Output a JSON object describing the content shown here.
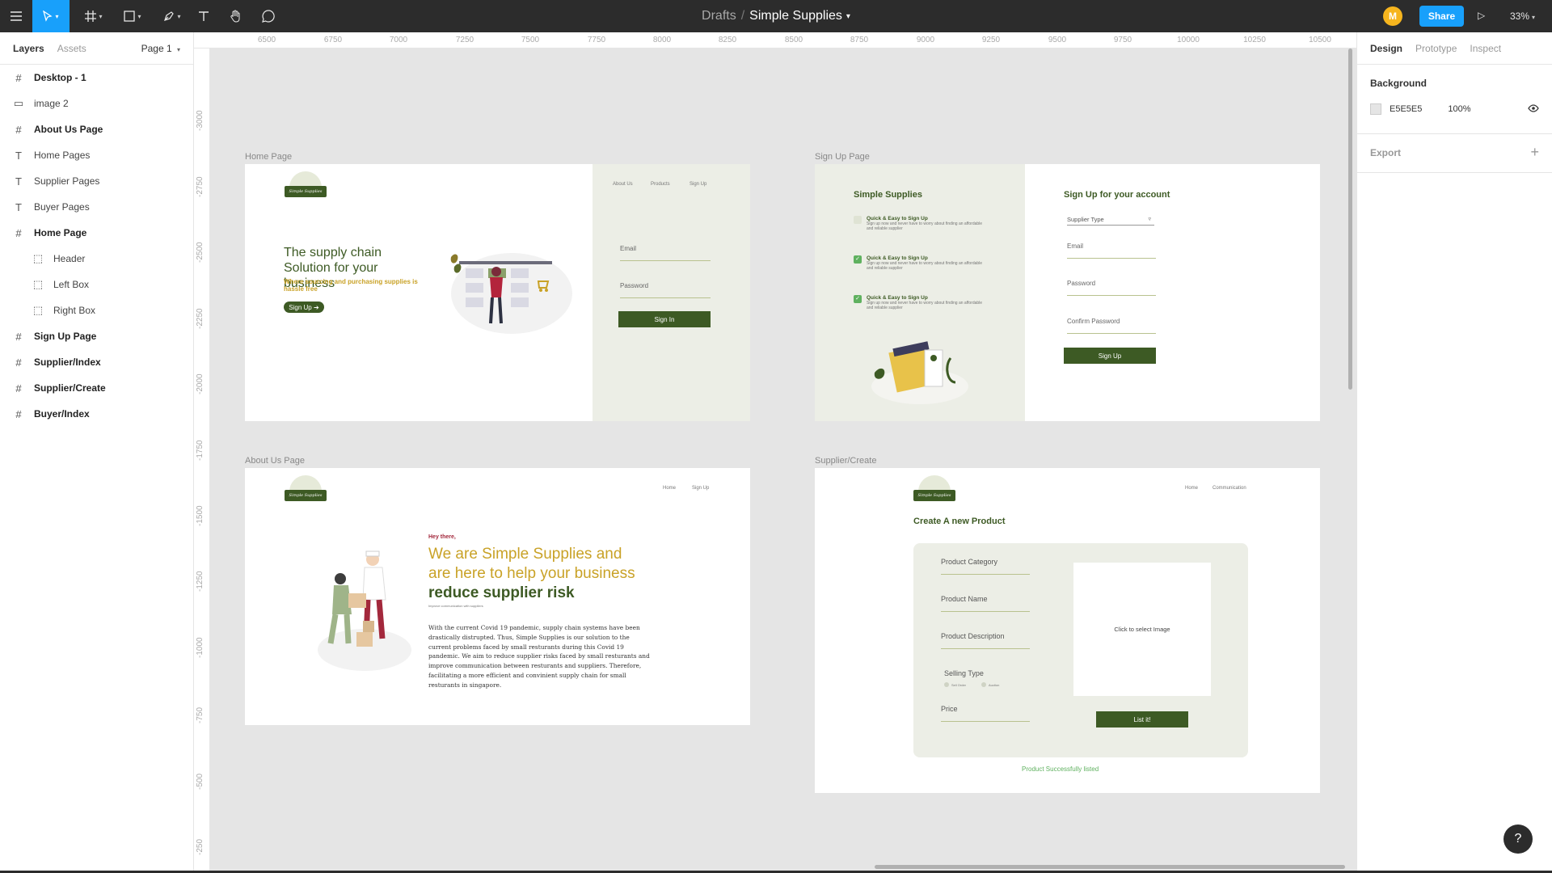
{
  "topbar": {
    "menu_icon": "hamburger-icon",
    "tools": [
      "move-tool",
      "frame-tool",
      "shape-tool",
      "pen-tool",
      "text-tool",
      "hand-tool",
      "comment-tool"
    ],
    "breadcrumb_root": "Drafts",
    "breadcrumb_sep": "/",
    "file_name": "Simple Supplies",
    "avatar_initial": "M",
    "share_label": "Share",
    "zoom": "33%"
  },
  "left_panel": {
    "tabs": [
      "Layers",
      "Assets"
    ],
    "page_selector": "Page 1",
    "layers": [
      {
        "label": "Desktop - 1",
        "icon": "#"
      },
      {
        "label": "image 2",
        "icon": "▭"
      },
      {
        "label": "About Us Page",
        "icon": "#"
      },
      {
        "label": "Home Pages",
        "icon": "T"
      },
      {
        "label": "Supplier Pages",
        "icon": "T"
      },
      {
        "label": "Buyer Pages",
        "icon": "T"
      },
      {
        "label": "Home Page",
        "icon": "#"
      },
      {
        "label": "Header",
        "icon": "⬚"
      },
      {
        "label": "Left Box",
        "icon": "⬚"
      },
      {
        "label": "Right Box",
        "icon": "⬚"
      },
      {
        "label": "Sign Up Page",
        "icon": "#"
      },
      {
        "label": "Supplier/Index",
        "icon": "#"
      },
      {
        "label": "Supplier/Create",
        "icon": "#"
      },
      {
        "label": "Buyer/Index",
        "icon": "#"
      }
    ]
  },
  "right_panel": {
    "tabs": [
      "Design",
      "Prototype",
      "Inspect"
    ],
    "background_heading": "Background",
    "background_hex": "E5E5E5",
    "background_opacity": "100%",
    "export_heading": "Export"
  },
  "rulers": {
    "horizontal": [
      "6500",
      "6750",
      "7000",
      "7250",
      "7500",
      "7750",
      "8000",
      "8250",
      "8500",
      "8750",
      "9000",
      "9250",
      "9500",
      "9750",
      "10000",
      "10250",
      "10500"
    ],
    "vertical": [
      "-3000",
      "-2750",
      "-2500",
      "-2250",
      "-2000",
      "-1750",
      "-1500",
      "-1250",
      "-1000",
      "-750",
      "-500",
      "-250"
    ]
  },
  "frames": {
    "home": {
      "label": "Home Page",
      "logo_text": "Simple Supplies",
      "nav": [
        "About Us",
        "Products",
        "Sign Up"
      ],
      "headline": "The supply chain Solution for your business",
      "subline": "Where sourcing and purchasing supplies is hassle free",
      "cta": "Sign Up ➔",
      "email_placeholder": "Email",
      "password_placeholder": "Password",
      "signin": "Sign In"
    },
    "signup": {
      "label": "Sign Up Page",
      "brand": "Simple Supplies",
      "features": [
        {
          "title": "Quick & Easy to Sign Up",
          "desc": "Sign up now and never have to worry about finding an affordable and reliable supplier"
        },
        {
          "title": "Quick & Easy to Sign Up",
          "desc": "Sign up now and never have to worry about finding an affordable and reliable supplier"
        },
        {
          "title": "Quick & Easy to Sign Up",
          "desc": "Sign up now and never have to worry about finding an affordable and reliable supplier"
        }
      ],
      "form_title": "Sign Up for your account",
      "supplier_type": "Supplier Type",
      "email": "Email",
      "password": "Password",
      "confirm_password": "Confirm Password",
      "submit": "Sign Up"
    },
    "about": {
      "label": "About Us Page",
      "logo_text": "Simple Supplies",
      "nav": [
        "Home",
        "Sign Up"
      ],
      "hey": "Hey there,",
      "line1": "We are Simple Supplies and",
      "line2": "are here to help your business",
      "line3": "reduce supplier risk",
      "tiny": "Improve communication with suppliers",
      "body": "With the current Covid 19 pandemic, supply chain systems have been drastically distrupted. Thus, Simple Supplies is our solution to the current problems faced by small resturants during this Covid 19 pandemic. We aim to reduce supplier risks faced by small resturants and improve communication between resturants and suppliers. Therefore, facilitating a more efficient and convinient supply chain for small resturants in singapore."
    },
    "create": {
      "label": "Supplier/Create",
      "logo_text": "Simple Supplies",
      "nav": [
        "Home",
        "Communication"
      ],
      "title": "Create A new Product",
      "category": "Product Category",
      "name": "Product Name",
      "description": "Product Description",
      "selling_type": "Selling Type",
      "radio1": "Sell Order",
      "radio2": "Auction",
      "price": "Price",
      "image_hint": "Click to select Image",
      "submit": "List it!",
      "success": "Product Successfully listed"
    }
  },
  "help": "?",
  "colors": {
    "brand_green": "#3d5a24",
    "accent_gold": "#c9a227",
    "figma_blue": "#18a0fb",
    "canvas_bg": "#e5e5e5"
  }
}
